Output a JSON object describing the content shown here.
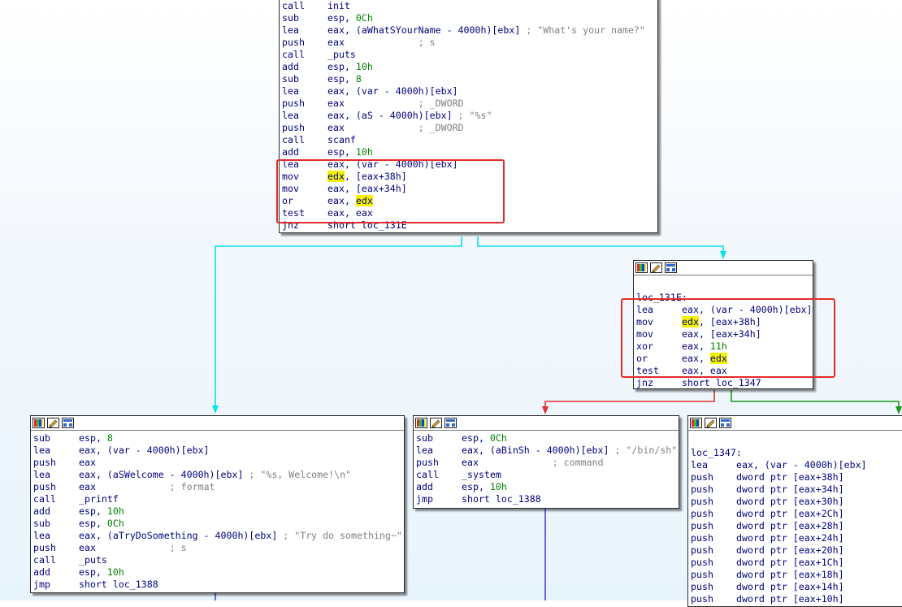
{
  "colors": {
    "edge_unconditional": "#00e5ee",
    "edge_true": "#1c9a1c",
    "edge_false": "#e03030",
    "edge_jump": "#3a3ad8",
    "highlight_box": "#e52b2b",
    "register_highlight": "#f3f300"
  },
  "header_icons": [
    "color-palette-icon",
    "edit-pencil-icon",
    "graph-view-icon"
  ],
  "blocks": {
    "main": {
      "lines": [
        {
          "m": "call",
          "o": "init"
        },
        {
          "m": "sub",
          "o": "esp, 0Ch"
        },
        {
          "m": "lea",
          "o": "eax, (aWhatSYourName - 4000h)[ebx]",
          "c": "; \"What's your name?\""
        },
        {
          "m": "push",
          "o": "eax",
          "c": "; s"
        },
        {
          "m": "call",
          "o": "_puts"
        },
        {
          "m": "add",
          "o": "esp, 10h"
        },
        {
          "m": "sub",
          "o": "esp, 8"
        },
        {
          "m": "lea",
          "o": "eax, (var - 4000h)[ebx]"
        },
        {
          "m": "push",
          "o": "eax",
          "c": "; _DWORD"
        },
        {
          "m": "lea",
          "o": "eax, (aS - 4000h)[ebx]",
          "c": "; \"%s\""
        },
        {
          "m": "push",
          "o": "eax",
          "c": "; _DWORD"
        },
        {
          "m": "call",
          "o": "scanf"
        },
        {
          "m": "add",
          "o": "esp, 10h"
        },
        {
          "m": "lea",
          "o": "eax, (var - 4000h)[ebx]"
        },
        {
          "m": "mov",
          "o": "edx, [eax+38h]"
        },
        {
          "m": "mov",
          "o": "eax, [eax+34h]"
        },
        {
          "m": "or",
          "o": "eax, edx"
        },
        {
          "m": "test",
          "o": "eax, eax"
        },
        {
          "m": "jnz",
          "o": "short loc_131E"
        }
      ]
    },
    "loc_131E": {
      "label": "loc_131E:",
      "lines": [
        {
          "m": "lea",
          "o": "eax, (var - 4000h)[ebx]"
        },
        {
          "m": "mov",
          "o": "edx, [eax+38h]"
        },
        {
          "m": "mov",
          "o": "eax, [eax+34h]"
        },
        {
          "m": "xor",
          "o": "eax, 11h"
        },
        {
          "m": "or",
          "o": "eax, edx"
        },
        {
          "m": "test",
          "o": "eax, eax"
        },
        {
          "m": "jnz",
          "o": "short loc_1347"
        }
      ]
    },
    "welcome": {
      "lines": [
        {
          "m": "sub",
          "o": "esp, 8"
        },
        {
          "m": "lea",
          "o": "eax, (var - 4000h)[ebx]"
        },
        {
          "m": "push",
          "o": "eax"
        },
        {
          "m": "lea",
          "o": "eax, (aSWelcome - 4000h)[ebx]",
          "c": "; \"%s, Welcome!\\n\""
        },
        {
          "m": "push",
          "o": "eax",
          "c": "; format"
        },
        {
          "m": "call",
          "o": "_printf"
        },
        {
          "m": "add",
          "o": "esp, 10h"
        },
        {
          "m": "sub",
          "o": "esp, 0Ch"
        },
        {
          "m": "lea",
          "o": "eax, (aTryDoSomething - 4000h)[ebx]",
          "c": "; \"Try do something~\""
        },
        {
          "m": "push",
          "o": "eax",
          "c": "; s"
        },
        {
          "m": "call",
          "o": "_puts"
        },
        {
          "m": "add",
          "o": "esp, 10h"
        },
        {
          "m": "jmp",
          "o": "short loc_1388"
        }
      ]
    },
    "system": {
      "lines": [
        {
          "m": "sub",
          "o": "esp, 0Ch"
        },
        {
          "m": "lea",
          "o": "eax, (aBinSh - 4000h)[ebx]",
          "c": "; \"/bin/sh\""
        },
        {
          "m": "push",
          "o": "eax",
          "c": "; command"
        },
        {
          "m": "call",
          "o": "_system"
        },
        {
          "m": "add",
          "o": "esp, 10h"
        },
        {
          "m": "jmp",
          "o": "short loc_1388"
        }
      ]
    },
    "loc_1347": {
      "label": "loc_1347:",
      "lines": [
        {
          "m": "lea",
          "o": "eax, (var - 4000h)[ebx]"
        },
        {
          "m": "push",
          "o": "dword ptr [eax+38h]"
        },
        {
          "m": "push",
          "o": "dword ptr [eax+34h]"
        },
        {
          "m": "push",
          "o": "dword ptr [eax+30h]"
        },
        {
          "m": "push",
          "o": "dword ptr [eax+2Ch]"
        },
        {
          "m": "push",
          "o": "dword ptr [eax+28h]"
        },
        {
          "m": "push",
          "o": "dword ptr [eax+24h]"
        },
        {
          "m": "push",
          "o": "dword ptr [eax+20h]"
        },
        {
          "m": "push",
          "o": "dword ptr [eax+1Ch]"
        },
        {
          "m": "push",
          "o": "dword ptr [eax+18h]"
        },
        {
          "m": "push",
          "o": "dword ptr [eax+14h]"
        },
        {
          "m": "push",
          "o": "dword ptr [eax+10h]"
        }
      ]
    }
  }
}
